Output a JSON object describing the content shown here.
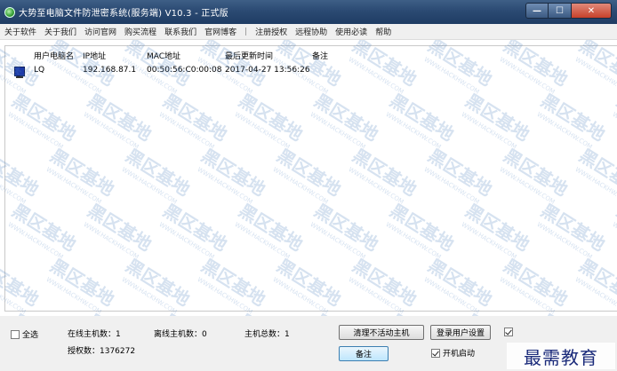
{
  "window": {
    "title": "大势至电脑文件防泄密系统(服务端) V10.3 - 正式版",
    "controls": {
      "minimize": "—",
      "maximize": "☐",
      "close": "✕"
    }
  },
  "menu": {
    "items": [
      "关于软件",
      "关于我们",
      "访问官网",
      "购买流程",
      "联系我们",
      "官网博客"
    ],
    "separator": "|",
    "items2": [
      "注册授权",
      "远程协助",
      "使用必读",
      "帮助"
    ]
  },
  "list": {
    "columns": [
      "用户电脑名",
      "IP地址",
      "MAC地址",
      "最后更新时间",
      "备注"
    ],
    "rows": [
      {
        "name": "LQ",
        "ip": "192.168.87.1",
        "mac": "00:50:56:C0:00:08",
        "updated": "2017-04-27 13:56:26",
        "note": ""
      }
    ]
  },
  "status": {
    "select_all": "全选",
    "online_hosts": "在线主机数：1",
    "offline_hosts": "离线主机数：0",
    "total_hosts": "主机总数：1",
    "license": "授权数：1376272",
    "clear_inactive_button": "清理不活动主机",
    "login_user_settings_button": "登录用户设置",
    "note_button": "备注",
    "autostart": "开机启动",
    "autostart_checked": true
  },
  "watermark": {
    "text": "黑区基地",
    "url": "WWW.HACKHW.COM"
  },
  "logo": {
    "text": "最需教育"
  }
}
